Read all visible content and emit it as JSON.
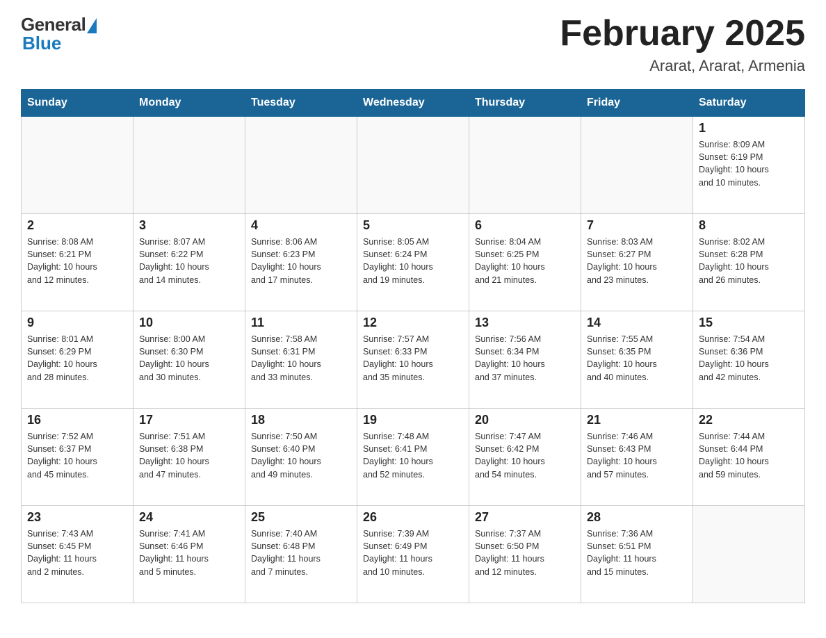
{
  "header": {
    "logo_general": "General",
    "logo_blue": "Blue",
    "month_title": "February 2025",
    "location": "Ararat, Ararat, Armenia"
  },
  "days_of_week": [
    "Sunday",
    "Monday",
    "Tuesday",
    "Wednesday",
    "Thursday",
    "Friday",
    "Saturday"
  ],
  "weeks": [
    [
      {
        "day": "",
        "info": ""
      },
      {
        "day": "",
        "info": ""
      },
      {
        "day": "",
        "info": ""
      },
      {
        "day": "",
        "info": ""
      },
      {
        "day": "",
        "info": ""
      },
      {
        "day": "",
        "info": ""
      },
      {
        "day": "1",
        "info": "Sunrise: 8:09 AM\nSunset: 6:19 PM\nDaylight: 10 hours\nand 10 minutes."
      }
    ],
    [
      {
        "day": "2",
        "info": "Sunrise: 8:08 AM\nSunset: 6:21 PM\nDaylight: 10 hours\nand 12 minutes."
      },
      {
        "day": "3",
        "info": "Sunrise: 8:07 AM\nSunset: 6:22 PM\nDaylight: 10 hours\nand 14 minutes."
      },
      {
        "day": "4",
        "info": "Sunrise: 8:06 AM\nSunset: 6:23 PM\nDaylight: 10 hours\nand 17 minutes."
      },
      {
        "day": "5",
        "info": "Sunrise: 8:05 AM\nSunset: 6:24 PM\nDaylight: 10 hours\nand 19 minutes."
      },
      {
        "day": "6",
        "info": "Sunrise: 8:04 AM\nSunset: 6:25 PM\nDaylight: 10 hours\nand 21 minutes."
      },
      {
        "day": "7",
        "info": "Sunrise: 8:03 AM\nSunset: 6:27 PM\nDaylight: 10 hours\nand 23 minutes."
      },
      {
        "day": "8",
        "info": "Sunrise: 8:02 AM\nSunset: 6:28 PM\nDaylight: 10 hours\nand 26 minutes."
      }
    ],
    [
      {
        "day": "9",
        "info": "Sunrise: 8:01 AM\nSunset: 6:29 PM\nDaylight: 10 hours\nand 28 minutes."
      },
      {
        "day": "10",
        "info": "Sunrise: 8:00 AM\nSunset: 6:30 PM\nDaylight: 10 hours\nand 30 minutes."
      },
      {
        "day": "11",
        "info": "Sunrise: 7:58 AM\nSunset: 6:31 PM\nDaylight: 10 hours\nand 33 minutes."
      },
      {
        "day": "12",
        "info": "Sunrise: 7:57 AM\nSunset: 6:33 PM\nDaylight: 10 hours\nand 35 minutes."
      },
      {
        "day": "13",
        "info": "Sunrise: 7:56 AM\nSunset: 6:34 PM\nDaylight: 10 hours\nand 37 minutes."
      },
      {
        "day": "14",
        "info": "Sunrise: 7:55 AM\nSunset: 6:35 PM\nDaylight: 10 hours\nand 40 minutes."
      },
      {
        "day": "15",
        "info": "Sunrise: 7:54 AM\nSunset: 6:36 PM\nDaylight: 10 hours\nand 42 minutes."
      }
    ],
    [
      {
        "day": "16",
        "info": "Sunrise: 7:52 AM\nSunset: 6:37 PM\nDaylight: 10 hours\nand 45 minutes."
      },
      {
        "day": "17",
        "info": "Sunrise: 7:51 AM\nSunset: 6:38 PM\nDaylight: 10 hours\nand 47 minutes."
      },
      {
        "day": "18",
        "info": "Sunrise: 7:50 AM\nSunset: 6:40 PM\nDaylight: 10 hours\nand 49 minutes."
      },
      {
        "day": "19",
        "info": "Sunrise: 7:48 AM\nSunset: 6:41 PM\nDaylight: 10 hours\nand 52 minutes."
      },
      {
        "day": "20",
        "info": "Sunrise: 7:47 AM\nSunset: 6:42 PM\nDaylight: 10 hours\nand 54 minutes."
      },
      {
        "day": "21",
        "info": "Sunrise: 7:46 AM\nSunset: 6:43 PM\nDaylight: 10 hours\nand 57 minutes."
      },
      {
        "day": "22",
        "info": "Sunrise: 7:44 AM\nSunset: 6:44 PM\nDaylight: 10 hours\nand 59 minutes."
      }
    ],
    [
      {
        "day": "23",
        "info": "Sunrise: 7:43 AM\nSunset: 6:45 PM\nDaylight: 11 hours\nand 2 minutes."
      },
      {
        "day": "24",
        "info": "Sunrise: 7:41 AM\nSunset: 6:46 PM\nDaylight: 11 hours\nand 5 minutes."
      },
      {
        "day": "25",
        "info": "Sunrise: 7:40 AM\nSunset: 6:48 PM\nDaylight: 11 hours\nand 7 minutes."
      },
      {
        "day": "26",
        "info": "Sunrise: 7:39 AM\nSunset: 6:49 PM\nDaylight: 11 hours\nand 10 minutes."
      },
      {
        "day": "27",
        "info": "Sunrise: 7:37 AM\nSunset: 6:50 PM\nDaylight: 11 hours\nand 12 minutes."
      },
      {
        "day": "28",
        "info": "Sunrise: 7:36 AM\nSunset: 6:51 PM\nDaylight: 11 hours\nand 15 minutes."
      },
      {
        "day": "",
        "info": ""
      }
    ]
  ]
}
